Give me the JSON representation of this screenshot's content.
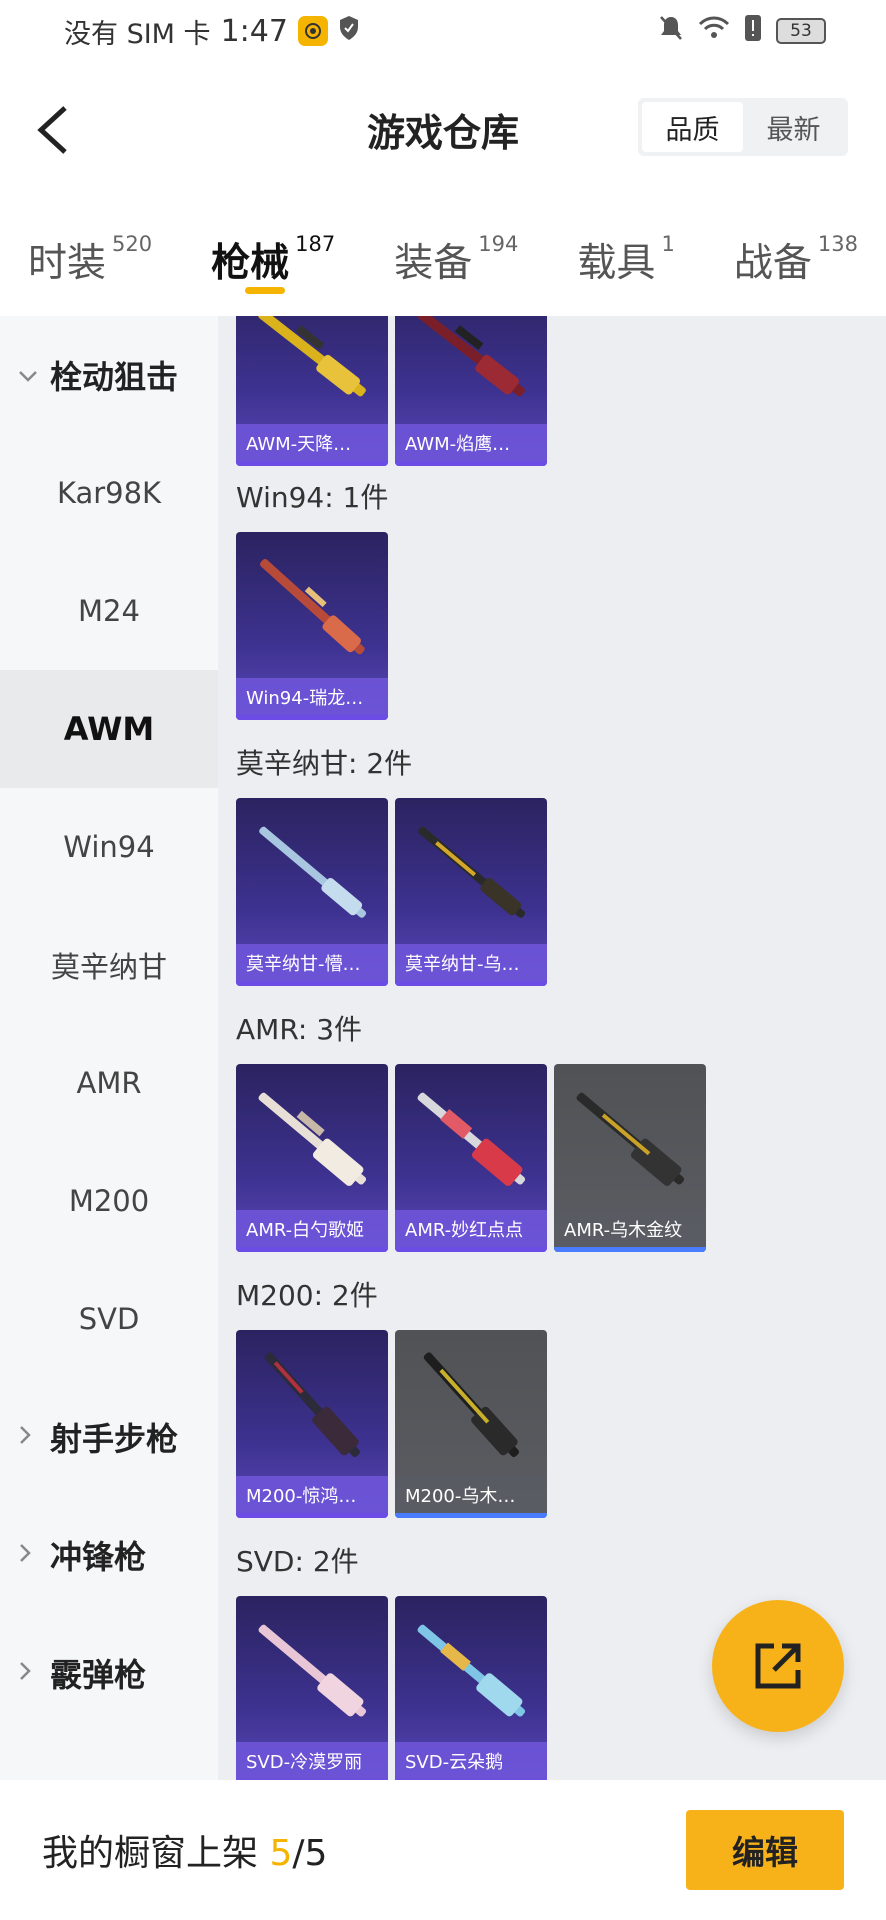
{
  "status_bar": {
    "carrier": "没有 SIM 卡",
    "time": "1:47",
    "battery": "53"
  },
  "header": {
    "title": "游戏仓库",
    "sort_options": [
      "品质",
      "最新"
    ],
    "active_sort": "品质"
  },
  "tabs": [
    {
      "label": "时装",
      "count": "520"
    },
    {
      "label": "枪械",
      "count": "187"
    },
    {
      "label": "装备",
      "count": "194"
    },
    {
      "label": "载具",
      "count": "1"
    },
    {
      "label": "战备",
      "count": "138"
    }
  ],
  "sidebar": {
    "group_open": "栓动狙击",
    "items": [
      "Kar98K",
      "M24",
      "AWM",
      "Win94",
      "莫辛纳甘",
      "AMR",
      "M200",
      "SVD"
    ],
    "active_item": "AWM",
    "groups_closed": [
      "射手步枪",
      "冲锋枪",
      "霰弹枪"
    ]
  },
  "sections": [
    {
      "title": "",
      "cards": [
        "AWM-天降…",
        "AWM-焰鹰…"
      ]
    },
    {
      "title": "Win94: 1件",
      "cards": [
        "Win94-瑞龙…"
      ]
    },
    {
      "title": "莫辛纳甘: 2件",
      "cards": [
        "莫辛纳甘-懵…",
        "莫辛纳甘-乌…"
      ]
    },
    {
      "title": "AMR: 3件",
      "cards": [
        "AMR-白勺歌姬",
        "AMR-妙红点点",
        "AMR-乌木金纹"
      ]
    },
    {
      "title": "M200: 2件",
      "cards": [
        "M200-惊鸿…",
        "M200-乌木…"
      ]
    },
    {
      "title": "SVD: 2件",
      "cards": [
        "SVD-冷漠罗丽",
        "SVD-云朵鹅"
      ]
    }
  ],
  "bottom_bar": {
    "label": "我的橱窗上架",
    "count_used": "5",
    "count_total": "/5",
    "edit_label": "编辑"
  },
  "colors": {
    "accent": "#f5b400",
    "card_purple": "#3d3290",
    "card_gray": "#5b5d62"
  }
}
